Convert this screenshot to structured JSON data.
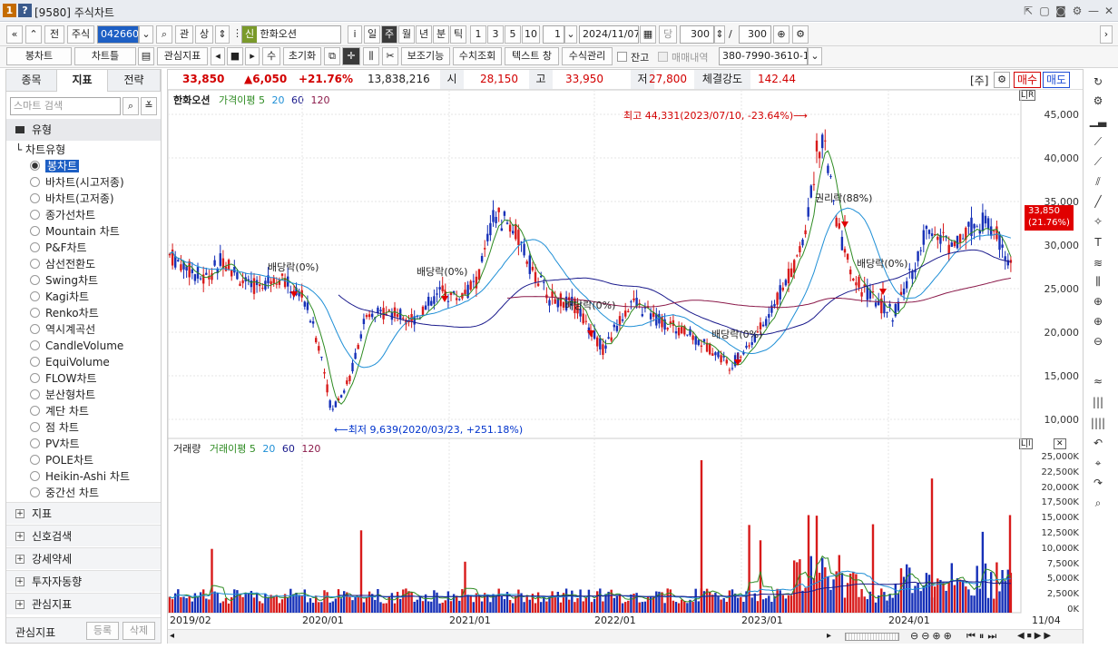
{
  "window": {
    "code": "[9580]",
    "title": "주식차트",
    "badge1": "1",
    "badge2": "?"
  },
  "toolbar1": {
    "period_buttons": [
      "일",
      "주",
      "월",
      "년",
      "분",
      "틱"
    ],
    "number_buttons": [
      "1",
      "3",
      "5",
      "10"
    ],
    "stock_code": "042660",
    "stock_name": "한화오션",
    "market_badge": "신",
    "label_prev": "전",
    "label_stock": "주식",
    "label_gwan": "관",
    "label_sang": "상",
    "label_i": "i",
    "spin_value": "1",
    "date": "2024/11/07",
    "dang": "당",
    "count1": "300",
    "count_total": "300"
  },
  "toolbar2": {
    "chart_type": "봉차트",
    "chart_frame": "차트틀",
    "indicators": "관심지표",
    "su": "수",
    "reset": "초기화",
    "aux": "보조기능",
    "num_lookup": "수치조회",
    "text_window": "텍스트 창",
    "formula": "수식관리",
    "balance_label": "잔고",
    "trade_label": "매매내역",
    "account": "380-7990-3610-1"
  },
  "left_panel": {
    "tabs": [
      "종목",
      "지표",
      "전략"
    ],
    "search_placeholder": "스마트 검색",
    "section": "유형",
    "tree_root": "차트유형",
    "chart_types": [
      "봉차트",
      "바차트(시고저종)",
      "바차트(고저종)",
      "종가선차트",
      "Mountain 차트",
      "P&F차트",
      "삼선전환도",
      "Swing차트",
      "Kagi차트",
      "Renko차트",
      "역시계곡선",
      "CandleVolume",
      "EquiVolume",
      "FLOW차트",
      "분산형차트",
      "계단 차트",
      "점 차트",
      "PV차트",
      "POLE차트",
      "Heikin-Ashi 차트",
      "중간선 차트"
    ],
    "groups": [
      "지표",
      "신호검색",
      "강세약세",
      "투자자동향",
      "관심지표"
    ],
    "footer_label": "관심지표",
    "btn_register": "등록",
    "btn_delete": "삭제"
  },
  "info_bar": {
    "price": "33,850",
    "change": "▲6,050",
    "change_pct": "+21.76%",
    "volume": "13,838,216",
    "open_label": "시",
    "open": "28,150",
    "high_label": "고",
    "high": "33,950",
    "low_label": "저",
    "low": "27,800",
    "strength_label": "체결강도",
    "strength": "142.44",
    "ju": "[주]",
    "buy": "매수",
    "sell": "매도"
  },
  "price_panel": {
    "legend_name": "한화오션",
    "legend_ma": "가격이평 5",
    "ma_periods": [
      "20",
      "60",
      "120"
    ],
    "y_ticks": [
      "45,000",
      "40,000",
      "35,000",
      "30,000",
      "25,000",
      "20,000",
      "15,000",
      "10,000"
    ],
    "current_tag": "33,850",
    "current_tag_pct": "(21.76%)",
    "max_note": "최고 44,331(2023/07/10, -23.64%)",
    "min_note": "최저 9,639(2020/03/23, +251.18%)",
    "dividend_note": "배당락(0%)",
    "rights_note": "권리락(88%)"
  },
  "volume_panel": {
    "legend_name": "거래량",
    "legend_ma": "거래이평 5",
    "ma_periods": [
      "20",
      "60",
      "120"
    ],
    "y_ticks": [
      "25,000K",
      "22,500K",
      "20,000K",
      "17,500K",
      "15,000K",
      "12,500K",
      "10,000K",
      "7,500K",
      "5,000K",
      "2,500K",
      "0K"
    ]
  },
  "x_axis": [
    "2019/02",
    "2020/01",
    "2021/01",
    "2022/01",
    "2023/01",
    "2024/01",
    "11/04"
  ],
  "colors": {
    "up": "#d81b1b",
    "down": "#1630b8",
    "ma5": "#2e8b22",
    "ma20": "#1f8fd6",
    "ma60": "#1a1a8c",
    "ma120": "#8b1a4a",
    "accent": "#d20000"
  }
}
